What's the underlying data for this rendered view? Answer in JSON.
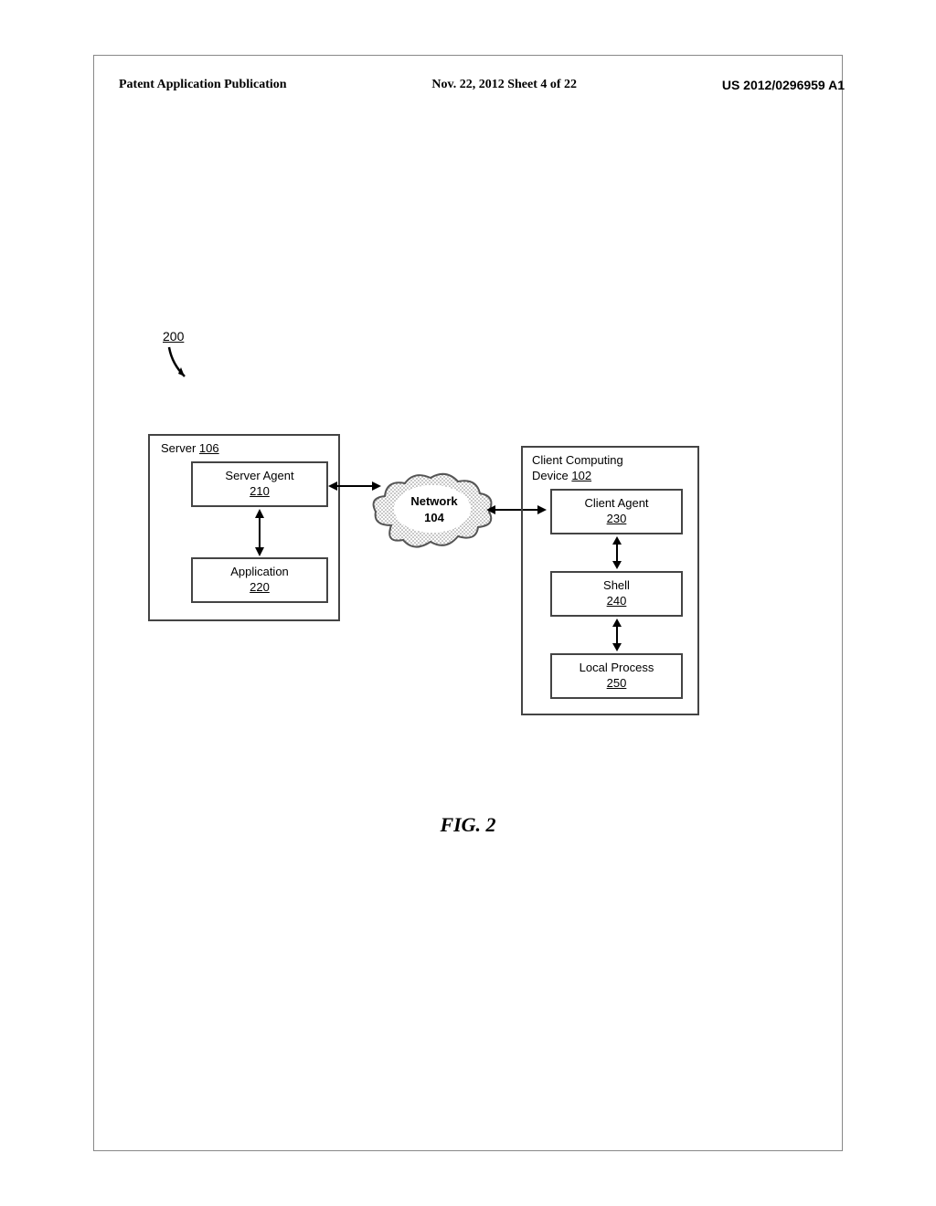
{
  "header": {
    "publication_label": "Patent Application Publication",
    "date_sheet": "Nov. 22, 2012  Sheet 4 of 22",
    "pub_number": "US 2012/0296959 A1"
  },
  "diagram": {
    "ref_200": "200",
    "server": {
      "title": "Server",
      "title_num": "106",
      "server_agent": {
        "label": "Server Agent",
        "num": "210"
      },
      "application": {
        "label": "Application",
        "num": "220"
      }
    },
    "network": {
      "label": "Network",
      "num": "104"
    },
    "client": {
      "title_line1": "Client Computing",
      "title_line2_prefix": "Device",
      "title_num": "102",
      "client_agent": {
        "label": "Client Agent",
        "num": "230"
      },
      "shell": {
        "label": "Shell",
        "num": "240"
      },
      "local_process": {
        "label": "Local Process",
        "num": "250"
      }
    }
  },
  "figure_label": "FIG. 2"
}
